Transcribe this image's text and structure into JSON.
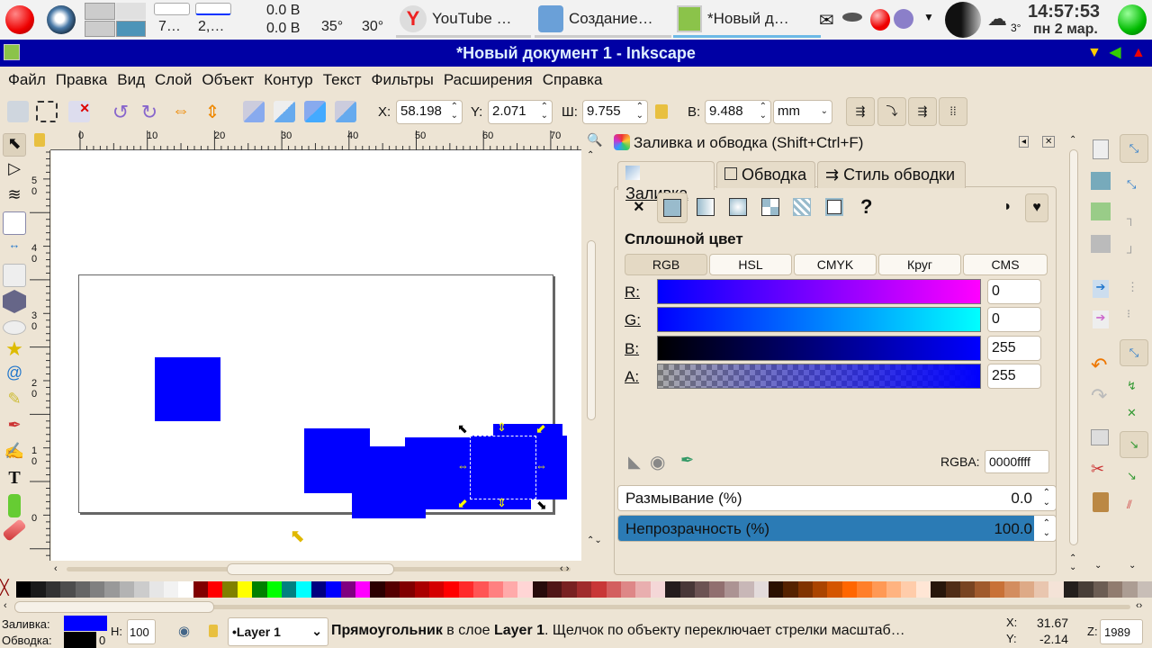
{
  "taskbar": {
    "widgets": {
      "cell1": "7…",
      "cell2": "2,…",
      "net_up": "0.0 B",
      "net_down": "0.0 B",
      "temp1": "35°",
      "temp2": "30°"
    },
    "tasks": [
      {
        "label": "YouTube …",
        "icon": "yandex-browser-icon"
      },
      {
        "label": "Создание…",
        "icon": "text-editor-icon"
      },
      {
        "label": "*Новый д…",
        "icon": "inkscape-icon"
      }
    ],
    "weather_temp": "3°",
    "clock_time": "14:57:53",
    "clock_date": "пн 2 мар."
  },
  "window": {
    "title": "*Новый документ 1 - Inkscape"
  },
  "menu": [
    "Файл",
    "Правка",
    "Вид",
    "Слой",
    "Объект",
    "Контур",
    "Текст",
    "Фильтры",
    "Расширения",
    "Справка"
  ],
  "toolbar": {
    "x_label": "X:",
    "x": "58.198",
    "y_label": "Y:",
    "y": "2.071",
    "w_label": "Ш:",
    "w": "9.755",
    "h_label": "В:",
    "h": "9.488",
    "unit": "mm"
  },
  "ruler": {
    "top": [
      "0",
      "10",
      "20",
      "30",
      "40",
      "50",
      "60",
      "70"
    ],
    "left": [
      "5\n0",
      "4\n0",
      "3\n0",
      "2\n0",
      "1\n0",
      "0"
    ]
  },
  "panel": {
    "title": "Заливка и обводка (Shift+Ctrl+F)",
    "tabs": [
      "Заливка",
      "Обводка",
      "Стиль обводки"
    ],
    "fill_none": "×",
    "unknown": "?",
    "mode_title": "Сплошной цвет",
    "color_modes": [
      "RGB",
      "HSL",
      "CMYK",
      "Круг",
      "CMS"
    ],
    "channels": [
      {
        "label": "R:",
        "value": "0"
      },
      {
        "label": "G:",
        "value": "0"
      },
      {
        "label": "B:",
        "value": "255"
      },
      {
        "label": "A:",
        "value": "255"
      }
    ],
    "rgba_label": "RGBA:",
    "rgba": "0000ffff",
    "blur_label": "Размывание (%)",
    "blur": "0.0",
    "opacity_label": "Непрозрачность (%)",
    "opacity": "100.0",
    "opacity_fraction": 1.0
  },
  "palette": [
    "#000000",
    "#1a1a1a",
    "#333333",
    "#4d4d4d",
    "#666666",
    "#808080",
    "#999999",
    "#b3b3b3",
    "#cccccc",
    "#e6e6e6",
    "#f2f2f2",
    "#ffffff",
    "#800000",
    "#ff0000",
    "#808000",
    "#ffff00",
    "#008000",
    "#00ff00",
    "#008080",
    "#00ffff",
    "#000080",
    "#0000ff",
    "#800080",
    "#ff00ff",
    "#2b0000",
    "#550000",
    "#800000",
    "#aa0000",
    "#d40000",
    "#ff0000",
    "#ff2a2a",
    "#ff5555",
    "#ff8080",
    "#ffaaaa",
    "#ffd5d5",
    "#280b0b",
    "#501616",
    "#782121",
    "#a02c2c",
    "#c83737",
    "#d35f5f",
    "#de8787",
    "#e9afaf",
    "#f4d7d7",
    "#241c1c",
    "#483737",
    "#6c5353",
    "#916f6f",
    "#ac9393",
    "#c8b7b7",
    "#e3dbdb",
    "#2b1100",
    "#552200",
    "#803300",
    "#aa4400",
    "#d45500",
    "#ff6600",
    "#ff7f2a",
    "#ff9955",
    "#ffb380",
    "#ffccaa",
    "#ffe6d5",
    "#28170b",
    "#502d16",
    "#784421",
    "#a05a2c",
    "#c87137",
    "#d38d5f",
    "#deaa87",
    "#e9c6af",
    "#f4e3d7",
    "#241f1c",
    "#483e37",
    "#6c5d53",
    "#917c6f",
    "#ac9d93",
    "#c8beb7"
  ],
  "status": {
    "fill_label": "Заливка:",
    "stroke_label": "Обводка:",
    "fill_color": "#0000ff",
    "stroke_color": "#000000",
    "stroke_width": "0",
    "opacity_label": "Н:",
    "opacity": "100",
    "layer": "•Layer 1",
    "message_bold": "Прямоугольник",
    "message_mid": " в слое ",
    "message_layer": "Layer 1",
    "message_rest": ". Щелчок по объекту переключает стрелки масштаб…",
    "cursor_x_label": "X:",
    "cursor_x": "31.67",
    "cursor_y_label": "Y:",
    "cursor_y": "-2.14",
    "zoom_label": "Z:",
    "zoom": "1989"
  }
}
